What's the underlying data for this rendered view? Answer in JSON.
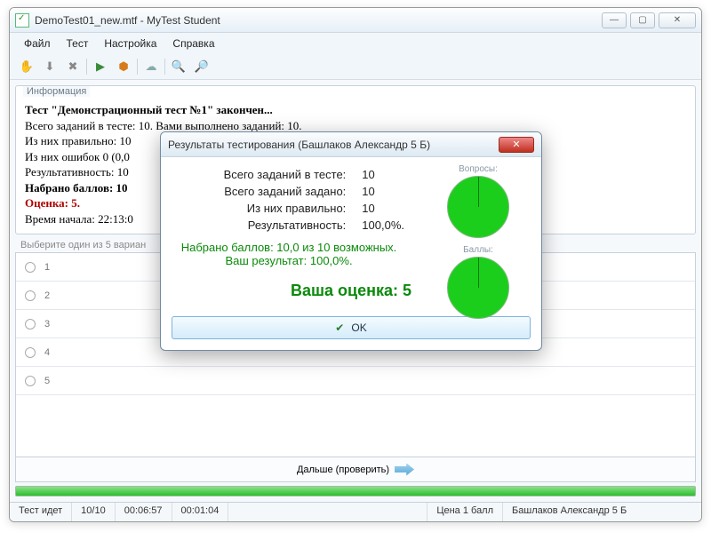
{
  "window": {
    "title": "DemoTest01_new.mtf - MyTest Student"
  },
  "menu": {
    "file": "Файл",
    "test": "Тест",
    "settings": "Настройка",
    "help": "Справка"
  },
  "info": {
    "legend": "Информация",
    "line1": "Тест \"Демонстрационный тест №1\" закончен...",
    "line2": "Всего заданий в тесте: 10. Вами выполнено заданий: 10.",
    "line3": "Из них правильно: 10",
    "line4": "Из них ошибок 0 (0,0",
    "line5": "Результативность: 10",
    "line6": "Набрано баллов: 10",
    "grade_line": "Оценка: 5.",
    "time_line": "Время начала: 22:13:0"
  },
  "question": {
    "hint": "Выберите один из 5 вариан",
    "opts": [
      "1",
      "2",
      "3",
      "4",
      "5"
    ],
    "next_label": "Дальше (проверить)"
  },
  "status": {
    "state": "Тест идет",
    "progress": "10/10",
    "t1": "00:06:57",
    "t2": "00:01:04",
    "price": "Цена 1 балл",
    "user": "Башлаков Александр 5 Б"
  },
  "modal": {
    "title": "Результаты тестирования (Башлаков Александр 5 Б)",
    "rows": {
      "total_label": "Всего заданий в тесте:",
      "total_val": "10",
      "asked_label": "Всего заданий задано:",
      "asked_val": "10",
      "correct_label": "Из них правильно:",
      "correct_val": "10",
      "eff_label": "Результативность:",
      "eff_val": "100,0%."
    },
    "score_line": "Набрано баллов: 10,0 из 10 возможных.",
    "result_line": "Ваш результат: 100,0%.",
    "grade": "Ваша оценка: 5",
    "pie1": "Вопросы:",
    "pie2": "Баллы:",
    "ok": "OK"
  }
}
